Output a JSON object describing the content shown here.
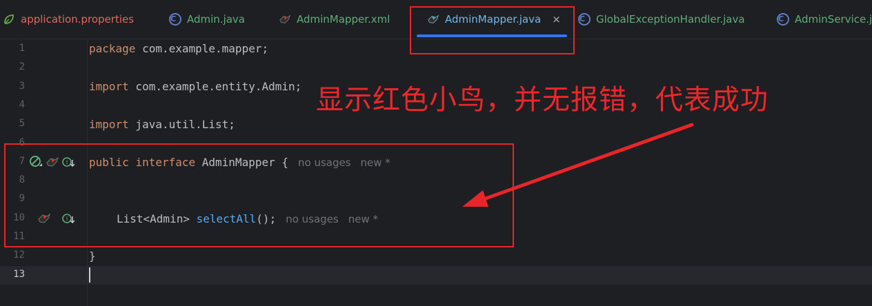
{
  "tabs": [
    {
      "label": "application.properties",
      "icon": "spring-leaf-icon"
    },
    {
      "label": "Admin.java",
      "icon": "class-icon"
    },
    {
      "label": "AdminMapper.xml",
      "icon": "mybatis-bird-icon"
    },
    {
      "label": "AdminMapper.java",
      "icon": "mybatis-bird-icon",
      "active": true
    },
    {
      "label": "GlobalExceptionHandler.java",
      "icon": "class-icon"
    },
    {
      "label": "AdminService.ja",
      "icon": "class-icon"
    }
  ],
  "close_symbol": "×",
  "line_numbers": [
    "1",
    "2",
    "3",
    "4",
    "5",
    "6",
    "7",
    "8",
    "9",
    "10",
    "11",
    "12",
    "13"
  ],
  "code": {
    "line1": {
      "kw": "package",
      "rest": " com.example.mapper;"
    },
    "line3": {
      "kw": "import",
      "rest": " com.example.entity.Admin;"
    },
    "line5": {
      "kw": "import",
      "rest": " java.util.List;"
    },
    "line7": {
      "kw1": "public",
      "kw2": "interface",
      "rest": " AdminMapper {"
    },
    "line10": {
      "pre": "List<Admin> ",
      "method": "selectAll",
      "post": "();"
    },
    "line12": "}"
  },
  "hints": {
    "usages": "no usages",
    "new": "new *"
  },
  "annotation": "显示红色小鸟，并无报错，代表成功",
  "colors": {
    "accent": "#3574f0",
    "annotation_red": "#e8262a"
  }
}
